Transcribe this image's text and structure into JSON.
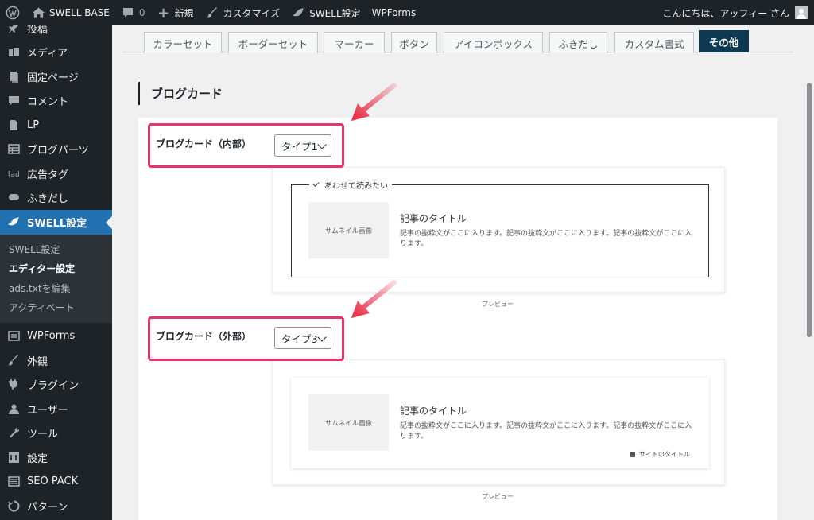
{
  "adminbar": {
    "site_name": "SWELL BASE",
    "comments_count": "0",
    "new_label": "新規",
    "customize_label": "カスタマイズ",
    "swell_settings_label": "SWELL設定",
    "wpforms_label": "WPForms",
    "greeting": "こんにちは、アッフィー さん"
  },
  "sidebar": {
    "items_top": [
      {
        "label": "投稿",
        "icon": "pin-icon"
      },
      {
        "label": "メディア",
        "icon": "media-icon"
      },
      {
        "label": "固定ページ",
        "icon": "page-icon"
      },
      {
        "label": "コメント",
        "icon": "comment-icon"
      },
      {
        "label": "LP",
        "icon": "document-icon"
      },
      {
        "label": "ブログパーツ",
        "icon": "table-icon"
      },
      {
        "label": "広告タグ",
        "icon": "ad-icon"
      },
      {
        "label": "ふきだし",
        "icon": "balloon-icon"
      }
    ],
    "current": {
      "label": "SWELL設定",
      "icon": "swell-icon"
    },
    "submenu": [
      "SWELL設定",
      "エディター設定",
      "ads.txtを編集",
      "アクティベート"
    ],
    "items_bottom": [
      {
        "label": "WPForms",
        "icon": "form-icon"
      },
      {
        "label": "外観",
        "icon": "brush-icon"
      },
      {
        "label": "プラグイン",
        "icon": "plugin-icon"
      },
      {
        "label": "ユーザー",
        "icon": "user-icon"
      },
      {
        "label": "ツール",
        "icon": "wrench-icon"
      },
      {
        "label": "設定",
        "icon": "settings-icon"
      },
      {
        "label": "SEO PACK",
        "icon": "list-icon"
      },
      {
        "label": "パターン",
        "icon": "pattern-icon"
      }
    ]
  },
  "tabs": [
    "カラーセット",
    "ボーダーセット",
    "マーカー",
    "ボタン",
    "アイコンボックス",
    "ふきだし",
    "カスタム書式",
    "その他"
  ],
  "active_tab": "その他",
  "section": {
    "title": "ブログカード",
    "internal": {
      "label": "ブログカード（内部）",
      "select_value": "タイプ1",
      "caption": "あわせて読みたい",
      "thumb_text": "サムネイル画像",
      "card_title": "記事のタイトル",
      "excerpt": "記事の抜粋文がここに入ります。記事の抜粋文がここに入ります。記事の抜粋文がここに入ります。",
      "preview_label": "プレビュー"
    },
    "external": {
      "label": "ブログカード（外部）",
      "select_value": "タイプ3",
      "thumb_text": "サムネイル画像",
      "card_title": "記事のタイトル",
      "excerpt": "記事の抜粋文がここに入ります。記事の抜粋文がここに入ります。記事の抜粋文がここに入ります。",
      "site_name": "サイトのタイトル",
      "preview_label": "プレビュー"
    }
  },
  "colors": {
    "sidebar_bg": "#1d2327",
    "current_bg": "#2271b1",
    "active_tab_bg": "#0d3a52",
    "highlight": "#e8336b",
    "arrow": "#e8203a"
  }
}
